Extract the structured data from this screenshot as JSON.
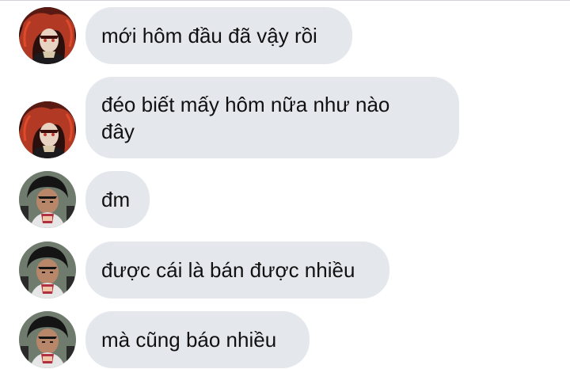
{
  "messages": [
    {
      "sender": "user-a",
      "text": "mới hôm đầu đã vậy rồi"
    },
    {
      "sender": "user-a",
      "text": "đéo biết mấy hôm nữa như nào\nđây"
    },
    {
      "sender": "user-b",
      "text": "đm"
    },
    {
      "sender": "user-b",
      "text": "được cái là bán được nhiều"
    },
    {
      "sender": "user-b",
      "text": "mà cũng báo nhiều"
    }
  ],
  "colors": {
    "bubble": "#e4e8ed",
    "text": "#111111",
    "background": "#ffffff",
    "avatar_a_accent": "#c0392b",
    "avatar_b_accent": "#2e3b2f"
  }
}
